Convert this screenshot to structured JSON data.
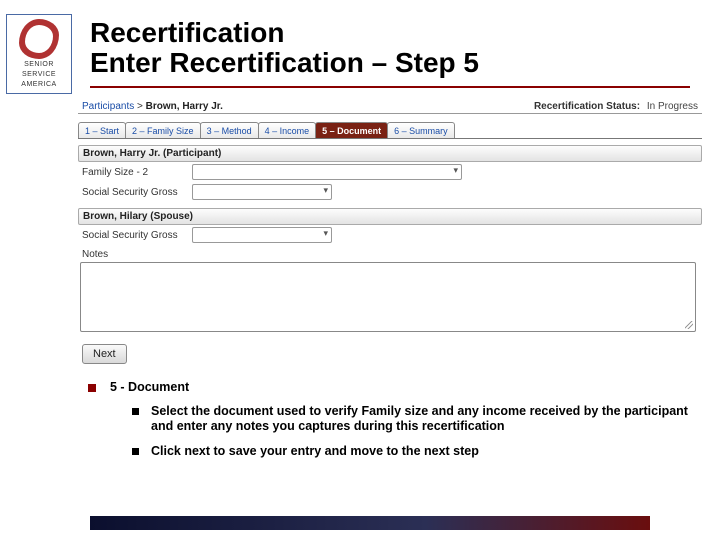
{
  "logo": {
    "line1": "SENIOR",
    "line2": "SERVICE",
    "line3": "AMERICA"
  },
  "title": {
    "line1": "Recertification",
    "line2": "Enter Recertification – Step 5"
  },
  "breadcrumb": {
    "link": "Participants",
    "sep": ">",
    "name": "Brown, Harry Jr."
  },
  "status": {
    "label": "Recertification Status:",
    "value": "In Progress"
  },
  "tabs": [
    {
      "label": "1 – Start"
    },
    {
      "label": "2 – Family Size"
    },
    {
      "label": "3 – Method"
    },
    {
      "label": "4 – Income"
    },
    {
      "label": "5 – Document",
      "active": true
    },
    {
      "label": "6 – Summary"
    }
  ],
  "sections": {
    "participant": {
      "header": "Brown, Harry Jr. (Participant)",
      "family_size_label": "Family Size - 2",
      "ssg_label": "Social Security Gross"
    },
    "spouse": {
      "header": "Brown, Hilary (Spouse)",
      "ssg_label": "Social Security Gross"
    }
  },
  "notes_label": "Notes",
  "next_label": "Next",
  "content": {
    "heading": "5 - Document",
    "sub1": "Select the document used to verify Family size and any income received by the participant and enter any notes you captures during this recertification",
    "sub2": "Click next to save your entry and move to the next step"
  }
}
